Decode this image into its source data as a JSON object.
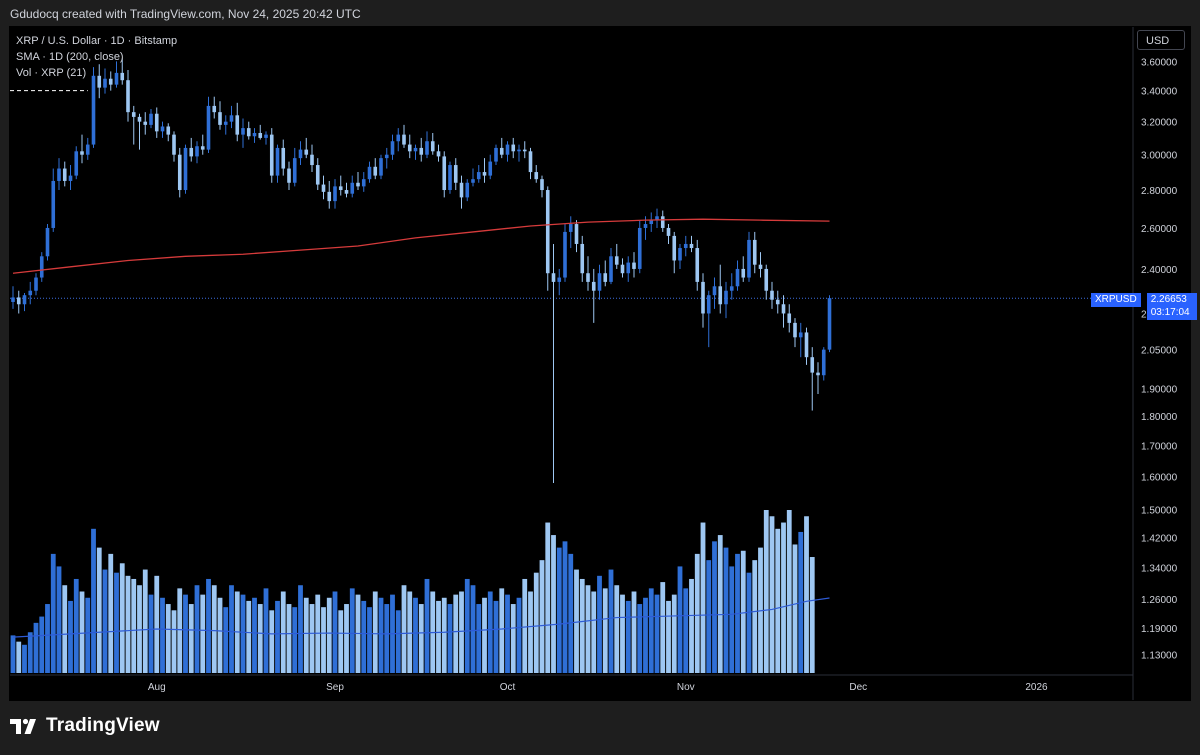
{
  "header": {
    "attribution": "Gdudocq created with TradingView.com, Nov 24, 2025 20:42 UTC"
  },
  "legend": {
    "symbol_line": "XRP / U.S. Dollar · 1D · Bitstamp",
    "sma_line": "SMA · 1D (200, close)",
    "vol_line": "Vol · XRP (21)"
  },
  "currency_button": "USD",
  "last_price": {
    "symbol": "XRPUSD",
    "price": "2.26653",
    "countdown": "03:17:04"
  },
  "brand": {
    "name": "TradingView"
  },
  "colors": {
    "background": "#000000",
    "up": "#2f6fd6",
    "down": "#9ec7f2",
    "sma": "#d63b3b",
    "vol_ma": "#2e5bd6",
    "price_tag": "#2962ff"
  },
  "chart_data": {
    "type": "candlestick",
    "scale": "log",
    "y_ticks": [
      "3.60000",
      "3.40000",
      "3.20000",
      "3.00000",
      "2.80000",
      "2.60000",
      "2.40000",
      "2.20000",
      "2.05000",
      "1.90000",
      "1.80000",
      "1.70000",
      "1.60000",
      "1.50000",
      "1.42000",
      "1.34000",
      "1.26000",
      "1.19000",
      "1.13000"
    ],
    "y_range": [
      1.09,
      3.85
    ],
    "x_ticks": [
      {
        "label": "Aug",
        "index": 25
      },
      {
        "label": "Sep",
        "index": 56
      },
      {
        "label": "Oct",
        "index": 86
      },
      {
        "label": "Nov",
        "index": 117
      },
      {
        "label": "Dec",
        "index": 147
      },
      {
        "label": "2026",
        "index": 178
      }
    ],
    "candles": [
      {
        "o": 2.25,
        "h": 2.32,
        "l": 2.22,
        "c": 2.27
      },
      {
        "o": 2.27,
        "h": 2.3,
        "l": 2.2,
        "c": 2.24
      },
      {
        "o": 2.24,
        "h": 2.29,
        "l": 2.21,
        "c": 2.28
      },
      {
        "o": 2.28,
        "h": 2.34,
        "l": 2.24,
        "c": 2.3
      },
      {
        "o": 2.3,
        "h": 2.38,
        "l": 2.28,
        "c": 2.36
      },
      {
        "o": 2.36,
        "h": 2.48,
        "l": 2.34,
        "c": 2.46
      },
      {
        "o": 2.46,
        "h": 2.62,
        "l": 2.44,
        "c": 2.6
      },
      {
        "o": 2.6,
        "h": 2.92,
        "l": 2.58,
        "c": 2.85
      },
      {
        "o": 2.85,
        "h": 2.98,
        "l": 2.8,
        "c": 2.92
      },
      {
        "o": 2.92,
        "h": 2.96,
        "l": 2.82,
        "c": 2.85
      },
      {
        "o": 2.85,
        "h": 2.94,
        "l": 2.8,
        "c": 2.88
      },
      {
        "o": 2.88,
        "h": 3.05,
        "l": 2.86,
        "c": 3.02
      },
      {
        "o": 3.02,
        "h": 3.12,
        "l": 2.95,
        "c": 3.0
      },
      {
        "o": 3.0,
        "h": 3.1,
        "l": 2.97,
        "c": 3.06
      },
      {
        "o": 3.06,
        "h": 3.56,
        "l": 3.04,
        "c": 3.5
      },
      {
        "o": 3.5,
        "h": 3.58,
        "l": 3.35,
        "c": 3.42
      },
      {
        "o": 3.42,
        "h": 3.55,
        "l": 3.38,
        "c": 3.48
      },
      {
        "o": 3.48,
        "h": 3.53,
        "l": 3.4,
        "c": 3.44
      },
      {
        "o": 3.44,
        "h": 3.6,
        "l": 3.42,
        "c": 3.52
      },
      {
        "o": 3.52,
        "h": 3.62,
        "l": 3.44,
        "c": 3.47
      },
      {
        "o": 3.47,
        "h": 3.54,
        "l": 3.2,
        "c": 3.26
      },
      {
        "o": 3.26,
        "h": 3.3,
        "l": 3.06,
        "c": 3.23
      },
      {
        "o": 3.23,
        "h": 3.25,
        "l": 3.03,
        "c": 3.2
      },
      {
        "o": 3.2,
        "h": 3.26,
        "l": 3.12,
        "c": 3.18
      },
      {
        "o": 3.18,
        "h": 3.28,
        "l": 3.16,
        "c": 3.25
      },
      {
        "o": 3.25,
        "h": 3.29,
        "l": 3.1,
        "c": 3.14
      },
      {
        "o": 3.14,
        "h": 3.2,
        "l": 3.1,
        "c": 3.17
      },
      {
        "o": 3.17,
        "h": 3.19,
        "l": 3.08,
        "c": 3.12
      },
      {
        "o": 3.12,
        "h": 3.14,
        "l": 2.96,
        "c": 3.0
      },
      {
        "o": 3.0,
        "h": 3.04,
        "l": 2.76,
        "c": 2.8
      },
      {
        "o": 2.8,
        "h": 3.06,
        "l": 2.78,
        "c": 3.04
      },
      {
        "o": 3.04,
        "h": 3.1,
        "l": 2.96,
        "c": 2.99
      },
      {
        "o": 2.99,
        "h": 3.08,
        "l": 2.95,
        "c": 3.05
      },
      {
        "o": 3.05,
        "h": 3.12,
        "l": 3.0,
        "c": 3.03
      },
      {
        "o": 3.03,
        "h": 3.36,
        "l": 3.01,
        "c": 3.3
      },
      {
        "o": 3.3,
        "h": 3.36,
        "l": 3.22,
        "c": 3.26
      },
      {
        "o": 3.26,
        "h": 3.33,
        "l": 3.15,
        "c": 3.18
      },
      {
        "o": 3.18,
        "h": 3.24,
        "l": 3.12,
        "c": 3.2
      },
      {
        "o": 3.2,
        "h": 3.3,
        "l": 3.16,
        "c": 3.24
      },
      {
        "o": 3.24,
        "h": 3.32,
        "l": 3.08,
        "c": 3.12
      },
      {
        "o": 3.12,
        "h": 3.22,
        "l": 3.04,
        "c": 3.16
      },
      {
        "o": 3.16,
        "h": 3.2,
        "l": 3.09,
        "c": 3.11
      },
      {
        "o": 3.11,
        "h": 3.16,
        "l": 3.07,
        "c": 3.13
      },
      {
        "o": 3.13,
        "h": 3.18,
        "l": 3.09,
        "c": 3.1
      },
      {
        "o": 3.1,
        "h": 3.14,
        "l": 3.06,
        "c": 3.12
      },
      {
        "o": 3.12,
        "h": 3.16,
        "l": 2.84,
        "c": 2.88
      },
      {
        "o": 2.88,
        "h": 3.06,
        "l": 2.84,
        "c": 3.04
      },
      {
        "o": 3.04,
        "h": 3.09,
        "l": 2.88,
        "c": 2.92
      },
      {
        "o": 2.92,
        "h": 2.96,
        "l": 2.8,
        "c": 2.84
      },
      {
        "o": 2.84,
        "h": 3.04,
        "l": 2.82,
        "c": 2.98
      },
      {
        "o": 2.98,
        "h": 3.08,
        "l": 2.94,
        "c": 3.03
      },
      {
        "o": 3.03,
        "h": 3.1,
        "l": 2.98,
        "c": 3.0
      },
      {
        "o": 3.0,
        "h": 3.06,
        "l": 2.9,
        "c": 2.94
      },
      {
        "o": 2.94,
        "h": 2.98,
        "l": 2.8,
        "c": 2.83
      },
      {
        "o": 2.83,
        "h": 2.88,
        "l": 2.75,
        "c": 2.79
      },
      {
        "o": 2.79,
        "h": 2.85,
        "l": 2.7,
        "c": 2.74
      },
      {
        "o": 2.74,
        "h": 2.86,
        "l": 2.7,
        "c": 2.82
      },
      {
        "o": 2.82,
        "h": 2.88,
        "l": 2.77,
        "c": 2.8
      },
      {
        "o": 2.8,
        "h": 2.84,
        "l": 2.76,
        "c": 2.78
      },
      {
        "o": 2.78,
        "h": 2.88,
        "l": 2.76,
        "c": 2.84
      },
      {
        "o": 2.84,
        "h": 2.9,
        "l": 2.8,
        "c": 2.82
      },
      {
        "o": 2.82,
        "h": 2.9,
        "l": 2.79,
        "c": 2.86
      },
      {
        "o": 2.86,
        "h": 2.96,
        "l": 2.84,
        "c": 2.93
      },
      {
        "o": 2.93,
        "h": 2.98,
        "l": 2.86,
        "c": 2.88
      },
      {
        "o": 2.88,
        "h": 3.0,
        "l": 2.86,
        "c": 2.98
      },
      {
        "o": 2.98,
        "h": 3.04,
        "l": 2.92,
        "c": 3.0
      },
      {
        "o": 3.0,
        "h": 3.12,
        "l": 2.97,
        "c": 3.08
      },
      {
        "o": 3.08,
        "h": 3.16,
        "l": 3.02,
        "c": 3.12
      },
      {
        "o": 3.12,
        "h": 3.18,
        "l": 3.04,
        "c": 3.06
      },
      {
        "o": 3.06,
        "h": 3.12,
        "l": 2.98,
        "c": 3.02
      },
      {
        "o": 3.02,
        "h": 3.06,
        "l": 2.97,
        "c": 3.04
      },
      {
        "o": 3.04,
        "h": 3.1,
        "l": 2.96,
        "c": 3.0
      },
      {
        "o": 3.0,
        "h": 3.14,
        "l": 2.98,
        "c": 3.08
      },
      {
        "o": 3.08,
        "h": 3.13,
        "l": 3.0,
        "c": 3.02
      },
      {
        "o": 3.02,
        "h": 3.06,
        "l": 2.96,
        "c": 2.99
      },
      {
        "o": 2.99,
        "h": 3.02,
        "l": 2.76,
        "c": 2.8
      },
      {
        "o": 2.8,
        "h": 2.96,
        "l": 2.78,
        "c": 2.94
      },
      {
        "o": 2.94,
        "h": 2.98,
        "l": 2.8,
        "c": 2.84
      },
      {
        "o": 2.84,
        "h": 2.88,
        "l": 2.7,
        "c": 2.76
      },
      {
        "o": 2.76,
        "h": 2.86,
        "l": 2.74,
        "c": 2.84
      },
      {
        "o": 2.84,
        "h": 2.92,
        "l": 2.82,
        "c": 2.86
      },
      {
        "o": 2.86,
        "h": 2.94,
        "l": 2.84,
        "c": 2.9
      },
      {
        "o": 2.9,
        "h": 2.98,
        "l": 2.84,
        "c": 2.88
      },
      {
        "o": 2.88,
        "h": 3.0,
        "l": 2.86,
        "c": 2.96
      },
      {
        "o": 2.96,
        "h": 3.06,
        "l": 2.94,
        "c": 3.04
      },
      {
        "o": 3.04,
        "h": 3.1,
        "l": 2.98,
        "c": 3.0
      },
      {
        "o": 3.0,
        "h": 3.08,
        "l": 2.96,
        "c": 3.06
      },
      {
        "o": 3.06,
        "h": 3.1,
        "l": 2.98,
        "c": 3.02
      },
      {
        "o": 3.02,
        "h": 3.06,
        "l": 2.96,
        "c": 3.03
      },
      {
        "o": 3.03,
        "h": 3.08,
        "l": 2.98,
        "c": 3.02
      },
      {
        "o": 3.02,
        "h": 3.04,
        "l": 2.86,
        "c": 2.9
      },
      {
        "o": 2.9,
        "h": 2.94,
        "l": 2.84,
        "c": 2.86
      },
      {
        "o": 2.86,
        "h": 2.88,
        "l": 2.76,
        "c": 2.8
      },
      {
        "o": 2.8,
        "h": 2.82,
        "l": 2.3,
        "c": 2.38
      },
      {
        "o": 2.38,
        "h": 2.52,
        "l": 1.58,
        "c": 2.34
      },
      {
        "o": 2.34,
        "h": 2.4,
        "l": 2.28,
        "c": 2.36
      },
      {
        "o": 2.36,
        "h": 2.62,
        "l": 2.34,
        "c": 2.58
      },
      {
        "o": 2.58,
        "h": 2.66,
        "l": 2.5,
        "c": 2.62
      },
      {
        "o": 2.62,
        "h": 2.64,
        "l": 2.48,
        "c": 2.52
      },
      {
        "o": 2.52,
        "h": 2.56,
        "l": 2.34,
        "c": 2.38
      },
      {
        "o": 2.38,
        "h": 2.46,
        "l": 2.3,
        "c": 2.34
      },
      {
        "o": 2.34,
        "h": 2.4,
        "l": 2.16,
        "c": 2.3
      },
      {
        "o": 2.3,
        "h": 2.42,
        "l": 2.26,
        "c": 2.38
      },
      {
        "o": 2.38,
        "h": 2.44,
        "l": 2.32,
        "c": 2.34
      },
      {
        "o": 2.34,
        "h": 2.5,
        "l": 2.33,
        "c": 2.46
      },
      {
        "o": 2.46,
        "h": 2.52,
        "l": 2.4,
        "c": 2.42
      },
      {
        "o": 2.42,
        "h": 2.45,
        "l": 2.36,
        "c": 2.38
      },
      {
        "o": 2.38,
        "h": 2.46,
        "l": 2.34,
        "c": 2.43
      },
      {
        "o": 2.43,
        "h": 2.48,
        "l": 2.36,
        "c": 2.4
      },
      {
        "o": 2.4,
        "h": 2.64,
        "l": 2.38,
        "c": 2.6
      },
      {
        "o": 2.6,
        "h": 2.66,
        "l": 2.54,
        "c": 2.62
      },
      {
        "o": 2.62,
        "h": 2.68,
        "l": 2.58,
        "c": 2.64
      },
      {
        "o": 2.64,
        "h": 2.7,
        "l": 2.6,
        "c": 2.66
      },
      {
        "o": 2.66,
        "h": 2.69,
        "l": 2.58,
        "c": 2.6
      },
      {
        "o": 2.6,
        "h": 2.62,
        "l": 2.52,
        "c": 2.56
      },
      {
        "o": 2.56,
        "h": 2.58,
        "l": 2.38,
        "c": 2.44
      },
      {
        "o": 2.44,
        "h": 2.52,
        "l": 2.4,
        "c": 2.5
      },
      {
        "o": 2.5,
        "h": 2.56,
        "l": 2.46,
        "c": 2.52
      },
      {
        "o": 2.52,
        "h": 2.56,
        "l": 2.48,
        "c": 2.5
      },
      {
        "o": 2.5,
        "h": 2.54,
        "l": 2.3,
        "c": 2.34
      },
      {
        "o": 2.34,
        "h": 2.38,
        "l": 2.14,
        "c": 2.2
      },
      {
        "o": 2.2,
        "h": 2.3,
        "l": 2.06,
        "c": 2.28
      },
      {
        "o": 2.28,
        "h": 2.36,
        "l": 2.22,
        "c": 2.32
      },
      {
        "o": 2.32,
        "h": 2.42,
        "l": 2.2,
        "c": 2.24
      },
      {
        "o": 2.24,
        "h": 2.34,
        "l": 2.18,
        "c": 2.3
      },
      {
        "o": 2.3,
        "h": 2.38,
        "l": 2.26,
        "c": 2.32
      },
      {
        "o": 2.32,
        "h": 2.44,
        "l": 2.3,
        "c": 2.4
      },
      {
        "o": 2.4,
        "h": 2.46,
        "l": 2.34,
        "c": 2.36
      },
      {
        "o": 2.36,
        "h": 2.58,
        "l": 2.34,
        "c": 2.54
      },
      {
        "o": 2.54,
        "h": 2.58,
        "l": 2.38,
        "c": 2.42
      },
      {
        "o": 2.42,
        "h": 2.48,
        "l": 2.36,
        "c": 2.4
      },
      {
        "o": 2.4,
        "h": 2.42,
        "l": 2.26,
        "c": 2.3
      },
      {
        "o": 2.3,
        "h": 2.34,
        "l": 2.22,
        "c": 2.26
      },
      {
        "o": 2.26,
        "h": 2.3,
        "l": 2.2,
        "c": 2.24
      },
      {
        "o": 2.24,
        "h": 2.28,
        "l": 2.14,
        "c": 2.2
      },
      {
        "o": 2.2,
        "h": 2.24,
        "l": 2.12,
        "c": 2.16
      },
      {
        "o": 2.16,
        "h": 2.18,
        "l": 2.06,
        "c": 2.1
      },
      {
        "o": 2.1,
        "h": 2.16,
        "l": 2.02,
        "c": 2.12
      },
      {
        "o": 2.12,
        "h": 2.14,
        "l": 1.99,
        "c": 2.02
      },
      {
        "o": 2.02,
        "h": 2.06,
        "l": 1.82,
        "c": 1.96
      },
      {
        "o": 1.96,
        "h": 2.0,
        "l": 1.88,
        "c": 1.95
      },
      {
        "o": 1.95,
        "h": 2.06,
        "l": 1.93,
        "c": 2.05
      },
      {
        "o": 2.05,
        "h": 2.28,
        "l": 2.04,
        "c": 2.267
      }
    ],
    "sma200": [
      {
        "i": 0,
        "v": 2.38
      },
      {
        "i": 10,
        "v": 2.41
      },
      {
        "i": 20,
        "v": 2.44
      },
      {
        "i": 30,
        "v": 2.46
      },
      {
        "i": 40,
        "v": 2.47
      },
      {
        "i": 50,
        "v": 2.49
      },
      {
        "i": 60,
        "v": 2.51
      },
      {
        "i": 70,
        "v": 2.55
      },
      {
        "i": 80,
        "v": 2.58
      },
      {
        "i": 90,
        "v": 2.61
      },
      {
        "i": 100,
        "v": 2.63
      },
      {
        "i": 110,
        "v": 2.64
      },
      {
        "i": 120,
        "v": 2.645
      },
      {
        "i": 130,
        "v": 2.64
      },
      {
        "i": 142,
        "v": 2.635
      }
    ],
    "volume": [
      12,
      10,
      9,
      13,
      16,
      18,
      22,
      38,
      34,
      28,
      23,
      30,
      26,
      24,
      46,
      40,
      33,
      38,
      32,
      35,
      31,
      30,
      28,
      33,
      25,
      31,
      24,
      22,
      20,
      27,
      25,
      22,
      28,
      25,
      30,
      28,
      24,
      21,
      28,
      26,
      25,
      23,
      24,
      22,
      27,
      20,
      23,
      26,
      22,
      21,
      28,
      24,
      22,
      25,
      21,
      24,
      26,
      20,
      22,
      27,
      25,
      23,
      21,
      26,
      24,
      22,
      25,
      20,
      28,
      26,
      24,
      22,
      30,
      26,
      23,
      24,
      22,
      25,
      26,
      30,
      28,
      22,
      24,
      26,
      23,
      27,
      25,
      22,
      24,
      30,
      26,
      32,
      36,
      48,
      44,
      40,
      42,
      38,
      33,
      30,
      28,
      26,
      31,
      27,
      33,
      28,
      25,
      23,
      26,
      22,
      24,
      27,
      25,
      29,
      23,
      25,
      34,
      27,
      30,
      38,
      48,
      36,
      42,
      44,
      40,
      34,
      38,
      39,
      32,
      36,
      40,
      52,
      50,
      46,
      48,
      52,
      41,
      45,
      50,
      37
    ],
    "vol_ma": [
      {
        "i": 0,
        "v": 0.22
      },
      {
        "i": 15,
        "v": 0.25
      },
      {
        "i": 25,
        "v": 0.27
      },
      {
        "i": 35,
        "v": 0.26
      },
      {
        "i": 45,
        "v": 0.24
      },
      {
        "i": 55,
        "v": 0.245
      },
      {
        "i": 65,
        "v": 0.24
      },
      {
        "i": 75,
        "v": 0.25
      },
      {
        "i": 85,
        "v": 0.27
      },
      {
        "i": 95,
        "v": 0.3
      },
      {
        "i": 105,
        "v": 0.34
      },
      {
        "i": 115,
        "v": 0.35
      },
      {
        "i": 125,
        "v": 0.36
      },
      {
        "i": 132,
        "v": 0.39
      },
      {
        "i": 138,
        "v": 0.44
      },
      {
        "i": 142,
        "v": 0.46
      }
    ],
    "last_close": 2.26653,
    "prior_resistance_dashed": 3.4
  }
}
